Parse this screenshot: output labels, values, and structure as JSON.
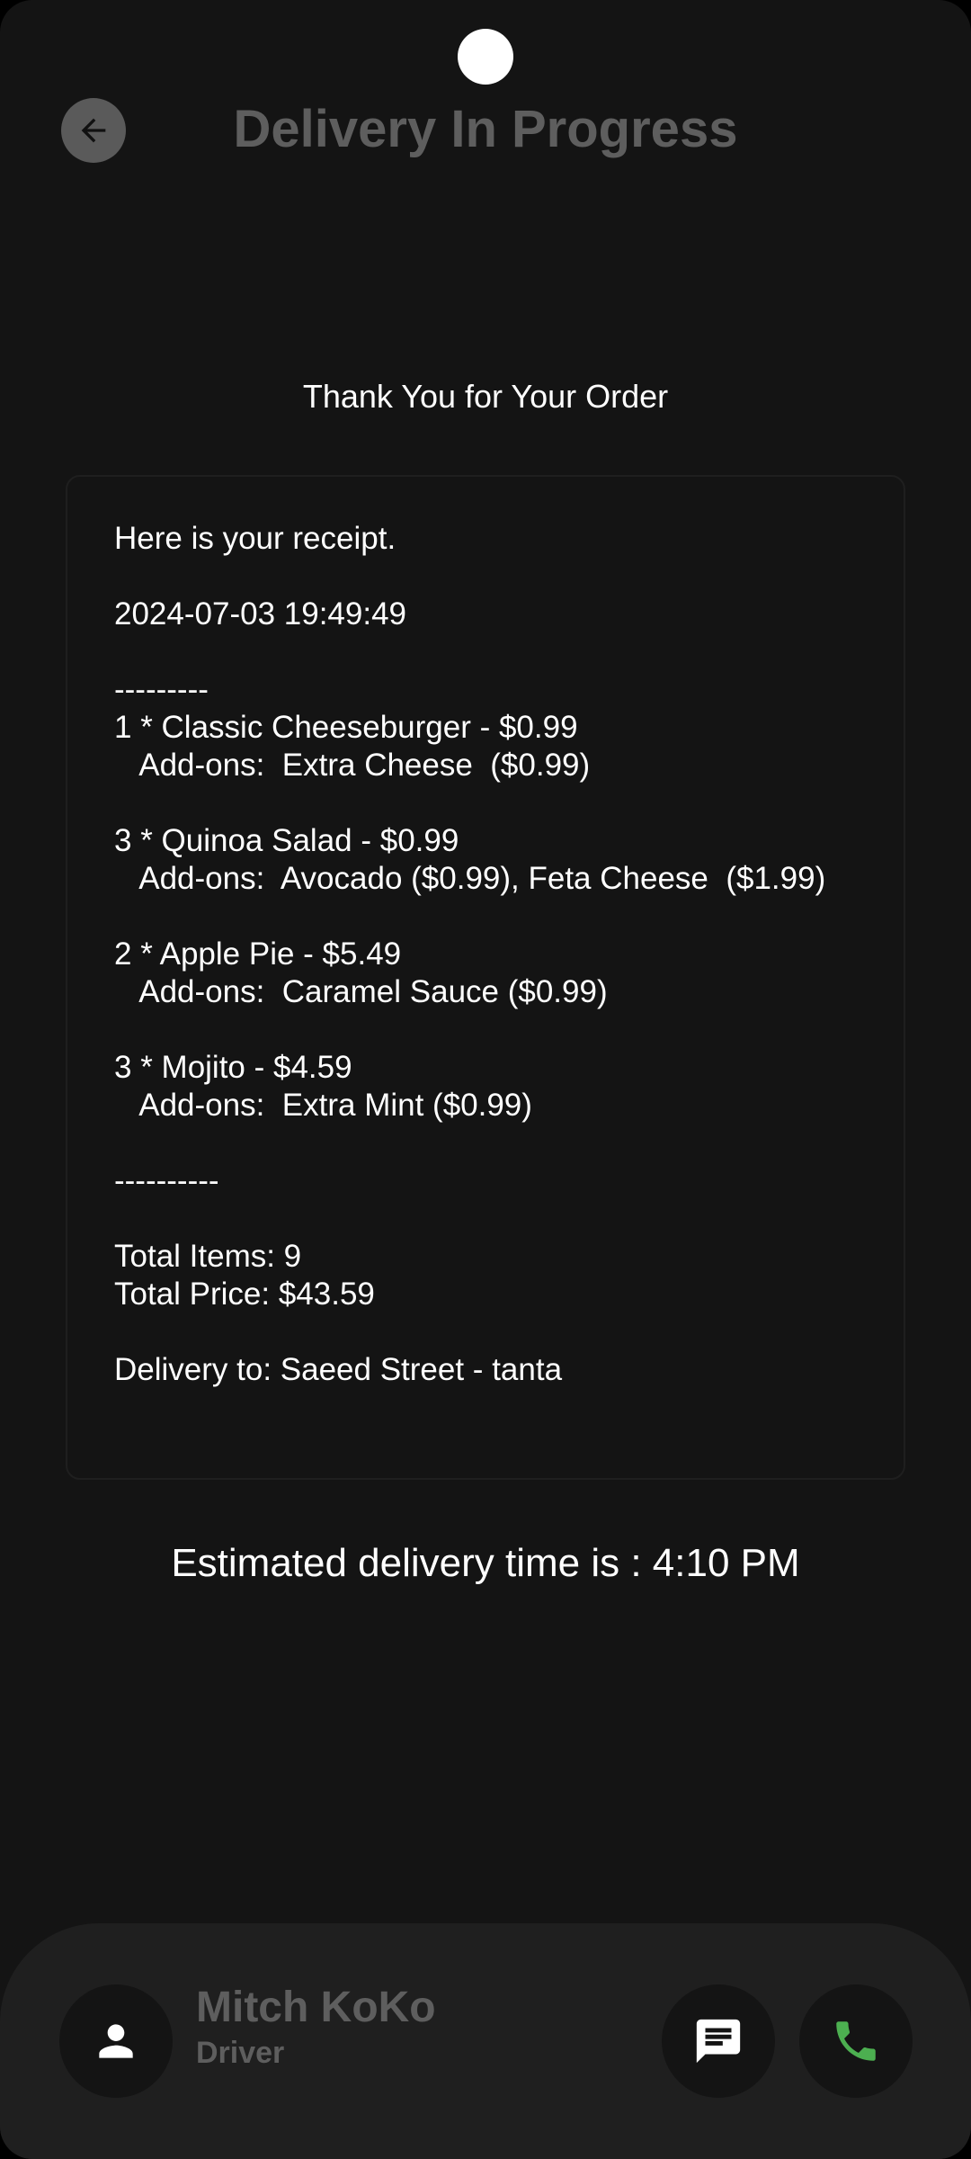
{
  "header": {
    "title": "Delivery In Progress",
    "back_icon": "arrow-back-icon"
  },
  "thanks_text": "Thank You for Your Order",
  "receipt": {
    "text": "Here is your receipt.\n\n2024-07-03 19:49:49\n\n---------\n1 * Classic Cheeseburger - $0.99\n   Add-ons:  Extra Cheese  ($0.99)\n\n3 * Quinoa Salad - $0.99\n   Add-ons:  Avocado ($0.99), Feta Cheese  ($1.99)\n\n2 * Apple Pie - $5.49\n   Add-ons:  Caramel Sauce ($0.99)\n\n3 * Mojito - $4.59\n   Add-ons:  Extra Mint ($0.99)\n\n----------\n\nTotal Items: 9\nTotal Price: $43.59\n\nDelivery to: Saeed Street - tanta"
  },
  "eta_text": "Estimated delivery time is : 4:10 PM",
  "driver": {
    "name": "Mitch KoKo",
    "role": "Driver",
    "avatar_icon": "person-icon",
    "message_icon": "chat-icon",
    "call_icon": "phone-icon"
  },
  "colors": {
    "background": "#141414",
    "panel": "#1f1f1f",
    "muted_text": "#5e5e5e",
    "call_green": "#4caf50"
  }
}
